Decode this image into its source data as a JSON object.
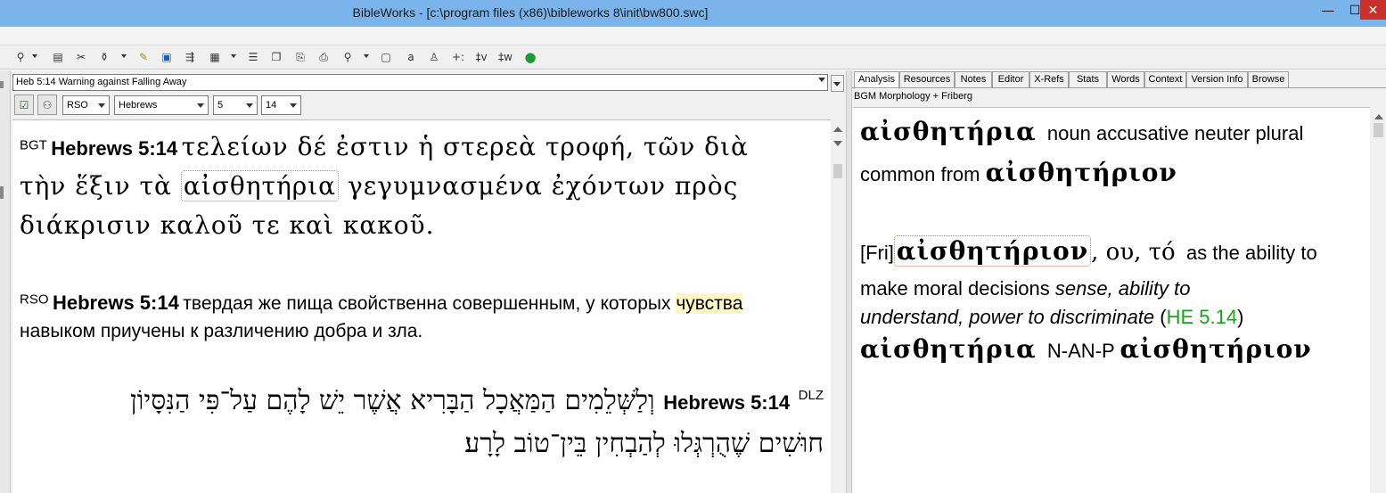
{
  "window": {
    "title": "BibleWorks - [c:\\program files (x86)\\bibleworks 8\\init\\bw800.swc]",
    "minimize_glyph": "—",
    "maximize_glyph": "☐",
    "close_glyph": "✕"
  },
  "toolbar": {
    "icons": [
      "search-icon",
      "toolbox-icon",
      "tools-icon",
      "lamp-icon",
      "highlighter-icon",
      "window-icon",
      "arrows-icon",
      "grid-icon",
      "list-icon",
      "copy-icon",
      "export-icon",
      "print-icon",
      "search2-icon",
      "window2-icon",
      "font-icon",
      "person-icon",
      "plus-icon",
      "verse-icon",
      "word-icon",
      "globe-icon"
    ],
    "glyphs": {
      "search-icon": "⚲",
      "toolbox-icon": "▤",
      "tools-icon": "✂",
      "lamp-icon": "⚱",
      "highlighter-icon": "✎",
      "window-icon": "▣",
      "arrows-icon": "⇶",
      "grid-icon": "▦",
      "list-icon": "☰",
      "copy-icon": "❐",
      "export-icon": "⎘",
      "print-icon": "⎙",
      "search2-icon": "⚲",
      "window2-icon": "▢",
      "font-icon": "a",
      "person-icon": "♙",
      "plus-icon": "+:",
      "verse-icon": "‡v",
      "word-icon": "‡w",
      "globe-icon": "●"
    }
  },
  "browse": {
    "verse_combo": "Heb 5:14 Warning against Falling Away",
    "check_glyph": "☑",
    "link_glyph": "⚇",
    "version_select": "RSO",
    "book_select": "Hebrews",
    "chapter_select": "5",
    "verse_select": "14"
  },
  "verses": [
    {
      "tag": "BGT",
      "ref": "Hebrews 5:14",
      "text_before": "τελείων δέ ἐστιν ἡ στερεὰ τροφή, τῶν διὰ τὴν ἕξιν τὰ ",
      "highlight": "αἰσθητήρια",
      "text_after": " γεγυμνασμένα ἐχόντων πρὸς διάκρισιν καλοῦ τε καὶ κακοῦ."
    },
    {
      "tag": "RSO",
      "ref": "Hebrews 5:14",
      "text_before": "твердая же пища свойственна совершенным, у которых ",
      "highlight": "чувства",
      "text_after": " навыком приучены к различению добра и зла."
    },
    {
      "tag": "DLZ",
      "ref": "Hebrews 5:14",
      "text": "וְלַשְּׁלֵמִים הַמַּאֲכָל הַבָּרִיא אֲשֶׁר יֵשׁ לָהֶם עַל־פִּי הַנִּסָּיוֹן חוּשִׁים שֶׁהֻרְגְּלוּ לְהַבְחִין בֵּין־טוֹב לָרָע׃"
    }
  ],
  "analysis": {
    "tabs": [
      "Analysis",
      "Resources",
      "Notes",
      "Editor",
      "X-Refs",
      "Stats",
      "Words",
      "Context",
      "Version Info",
      "Browse"
    ],
    "active_tab": "Analysis",
    "caption": "BGM Morphology + Friberg",
    "morph_word": "αἰσθητήρια",
    "morph_desc_1": "noun accusative neuter plural",
    "morph_desc_2": "common from",
    "morph_lemma": "αἰσθητήριον",
    "fri_tag": "[Fri]",
    "fri_lemma": "αἰσθητήριον",
    "fri_forms": ", ου, τό",
    "fri_def_1": "as the ability to",
    "fri_def_2": "make moral decisions",
    "fri_gloss_1": "sense, ability to",
    "fri_gloss_2": "understand, power to discriminate",
    "fri_ref_open": "(",
    "fri_ref": "HE 5.14",
    "fri_ref_close": ")",
    "parse_word": "αἰσθητήρια",
    "parse_code": "N-AN-P",
    "parse_lemma": "αἰσθητήριον"
  },
  "colors": {
    "titlebar": "#7bb4ea",
    "close": "#c9302c",
    "highlight": "#fff6c2",
    "link": "#1aa31a",
    "box_outline": "#d9774a"
  }
}
